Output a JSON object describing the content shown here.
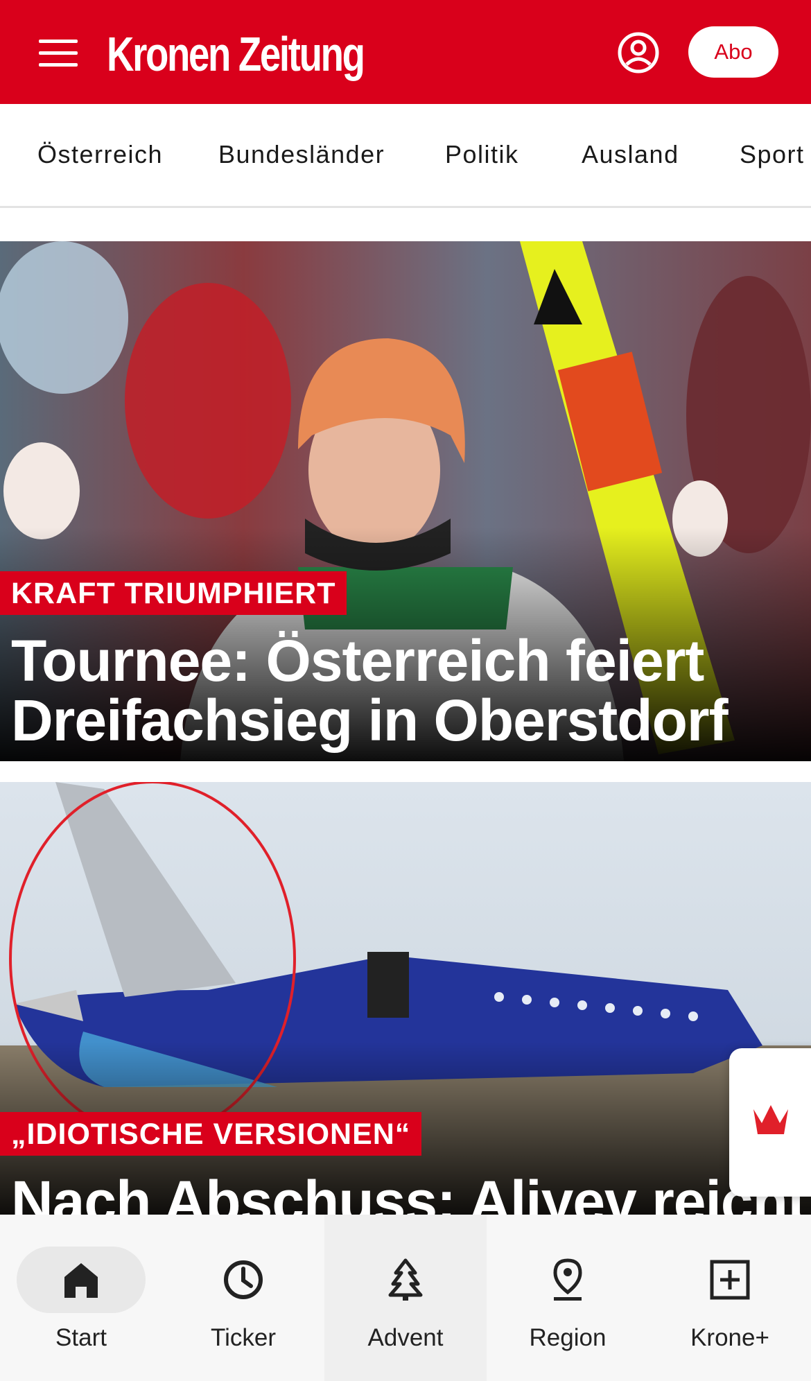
{
  "header": {
    "logo_text": "Kronen Zeitung",
    "abo_label": "Abo",
    "brand_color": "#d9001b"
  },
  "categories": [
    "Österreich",
    "Bundesländer",
    "Politik",
    "Ausland",
    "Sport"
  ],
  "articles": [
    {
      "kicker": "KRAFT TRIUMPHIERT",
      "headline_line1": "Tournee: Österreich feiert",
      "headline_line2": "Dreifachsieg in Oberstdorf"
    },
    {
      "kicker": "„IDIOTISCHE VERSIONEN“",
      "headline_line1": "Nach Abschuss: Aliyev reicht"
    }
  ],
  "bottom_nav": {
    "items": [
      {
        "label": "Start",
        "icon": "home-icon"
      },
      {
        "label": "Ticker",
        "icon": "clock-icon"
      },
      {
        "label": "Advent",
        "icon": "tree-icon"
      },
      {
        "label": "Region",
        "icon": "location-pin-icon"
      },
      {
        "label": "Krone+",
        "icon": "plus-box-icon"
      }
    ]
  }
}
